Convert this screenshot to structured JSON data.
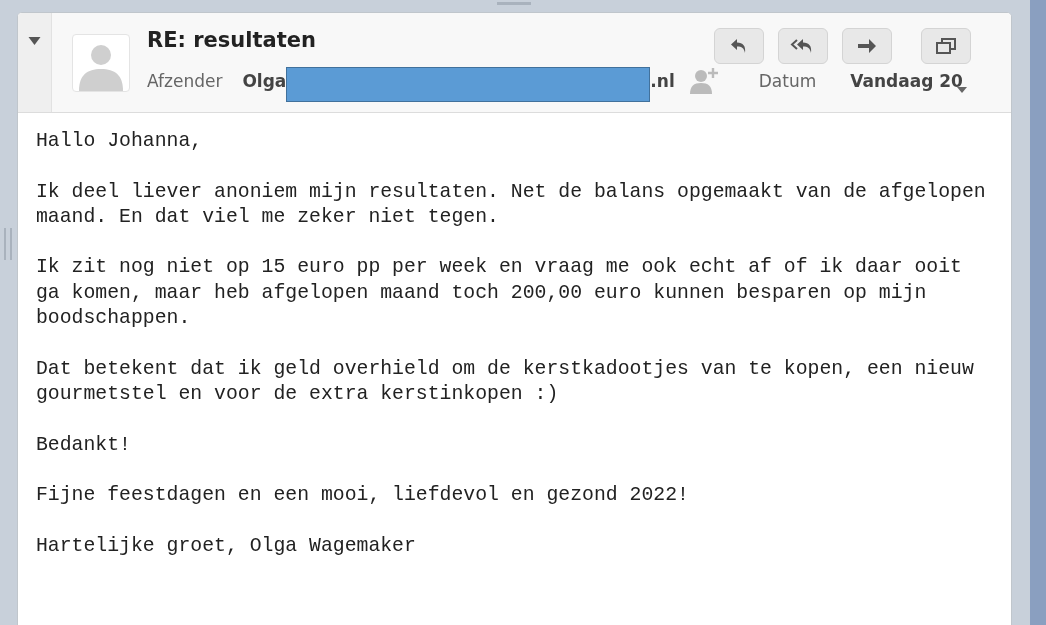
{
  "message": {
    "collapsed": false,
    "subject": "RE: resultaten",
    "sender_label": "Afzender",
    "sender_start": "Olga",
    "sender_end": ".nl",
    "date_label": "Datum",
    "date_value": "Vandaag 20",
    "body": [
      "Hallo Johanna,",
      "Ik deel liever anoniem mijn resultaten. Net de balans opgemaakt van de afgelopen maand. En dat viel me zeker niet tegen.",
      "Ik zit nog niet op 15 euro pp per week en vraag me ook echt af of ik daar ooit ga komen, maar heb afgelopen maand toch 200,00 euro kunnen besparen op mijn boodschappen.",
      "Dat betekent dat ik geld overhield om de kerstkadootjes van te kopen, een nieuw gourmetstel en voor de extra kerstinkopen :)",
      "Bedankt!",
      "Fijne feestdagen en een mooi, liefdevol en gezond 2022!",
      "Hartelijke groet, Olga Wagemaker"
    ]
  },
  "actions": [
    {
      "kind": "reply"
    },
    {
      "kind": "reply-all"
    },
    {
      "kind": "forward"
    },
    {
      "kind": "popout"
    }
  ]
}
